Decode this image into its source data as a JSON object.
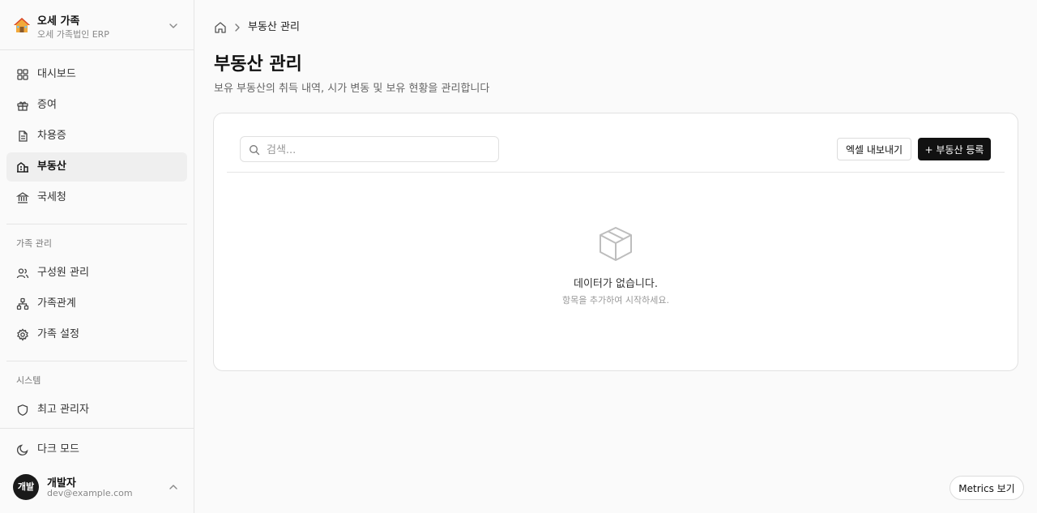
{
  "org": {
    "name": "오세 가족",
    "subtitle": "오세 가족법인 ERP"
  },
  "nav": {
    "main": [
      {
        "label": "대시보드",
        "icon": "dashboard-icon"
      },
      {
        "label": "증여",
        "icon": "gift-icon"
      },
      {
        "label": "차용증",
        "icon": "document-icon"
      },
      {
        "label": "부동산",
        "icon": "building-icon",
        "active": true
      },
      {
        "label": "국세청",
        "icon": "landmark-icon"
      }
    ],
    "family_section": "가족 관리",
    "family": [
      {
        "label": "구성원 관리",
        "icon": "users-icon"
      },
      {
        "label": "가족관계",
        "icon": "network-icon"
      },
      {
        "label": "가족 설정",
        "icon": "gear-icon"
      }
    ],
    "system_section": "시스템",
    "system": [
      {
        "label": "최고 관리자",
        "icon": "shield-icon"
      }
    ],
    "dark_mode": "다크 모드"
  },
  "user": {
    "initials": "개발",
    "name": "개발자",
    "email": "dev@example.com"
  },
  "breadcrumb": {
    "current": "부동산 관리"
  },
  "page": {
    "title": "부동산 관리",
    "description": "보유 부동산의 취득 내역, 시가 변동 및 보유 현황을 관리합니다"
  },
  "toolbar": {
    "search_placeholder": "검색...",
    "export_label": "엑셀 내보내기",
    "add_label": "+ 부동산 등록"
  },
  "empty": {
    "title": "데이터가 없습니다.",
    "subtitle": "항목을 추가하여 시작하세요."
  },
  "metrics_label": "Metrics 보기",
  "colors": {
    "primary": "#111111",
    "active_bg": "#efefef",
    "border": "#e5e5e5"
  }
}
